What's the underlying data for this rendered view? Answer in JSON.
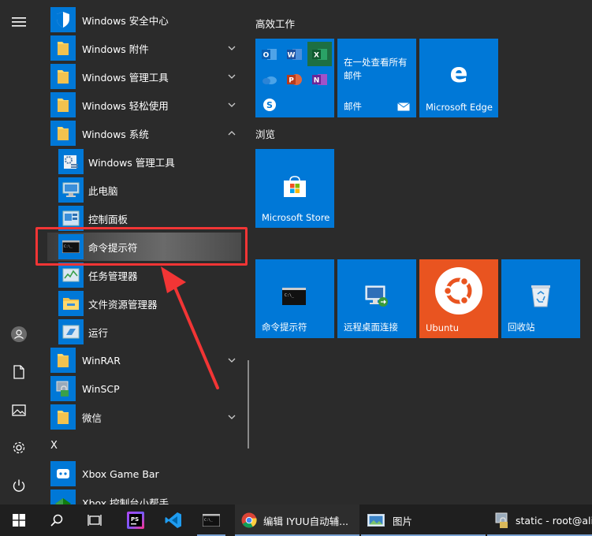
{
  "apps": [
    {
      "label": "Windows 安全中心",
      "icon": "shield-icon",
      "type": "app",
      "chevron": ""
    },
    {
      "label": "Windows 附件",
      "icon": "folder-icon",
      "type": "folder",
      "chevron": "down"
    },
    {
      "label": "Windows 管理工具",
      "icon": "folder-icon",
      "type": "folder",
      "chevron": "down"
    },
    {
      "label": "Windows 轻松使用",
      "icon": "folder-icon",
      "type": "folder",
      "chevron": "down"
    },
    {
      "label": "Windows 系统",
      "icon": "folder-icon",
      "type": "folder",
      "chevron": "up"
    },
    {
      "label": "Windows 管理工具",
      "icon": "admin-tools-icon",
      "type": "sub",
      "chevron": ""
    },
    {
      "label": "此电脑",
      "icon": "computer-icon",
      "type": "sub",
      "chevron": ""
    },
    {
      "label": "控制面板",
      "icon": "control-panel-icon",
      "type": "sub",
      "chevron": ""
    },
    {
      "label": "命令提示符",
      "icon": "cmd-icon",
      "type": "sub",
      "chevron": "",
      "selected": true
    },
    {
      "label": "任务管理器",
      "icon": "task-manager-icon",
      "type": "sub",
      "chevron": ""
    },
    {
      "label": "文件资源管理器",
      "icon": "file-explorer-icon",
      "type": "sub",
      "chevron": ""
    },
    {
      "label": "运行",
      "icon": "run-icon",
      "type": "sub",
      "chevron": ""
    },
    {
      "label": "WinRAR",
      "icon": "folder-icon",
      "type": "folder",
      "chevron": "down"
    },
    {
      "label": "WinSCP",
      "icon": "winscp-icon",
      "type": "app",
      "chevron": ""
    },
    {
      "label": "微信",
      "icon": "folder-icon",
      "type": "folder",
      "chevron": "down"
    },
    {
      "label": "X",
      "icon": "",
      "type": "letter",
      "chevron": ""
    },
    {
      "label": "Xbox Game Bar",
      "icon": "xbox-icon",
      "type": "app",
      "chevron": ""
    },
    {
      "label": "Xbox 控制台小帮手",
      "icon": "xbox-companion-icon",
      "type": "app",
      "chevron": ""
    }
  ],
  "groups": {
    "productivity": "高效工作",
    "browse": "浏览"
  },
  "tiles": {
    "mail_text": "在一处查看所有邮件",
    "mail_label": "邮件",
    "edge_label": "Microsoft Edge",
    "store_label": "Microsoft Store",
    "cmd_label": "命令提示符",
    "rdp_label": "远程桌面连接",
    "ubuntu_label": "Ubuntu",
    "recycle_label": "回收站"
  },
  "taskbar": {
    "chrome_label": "编辑 IYUU自动辅...",
    "photos_label": "图片",
    "ssh_label": "static - root@aliy"
  },
  "colors": {
    "accent": "#0078d7",
    "ubuntu": "#e95420",
    "highlight": "#f23535"
  }
}
